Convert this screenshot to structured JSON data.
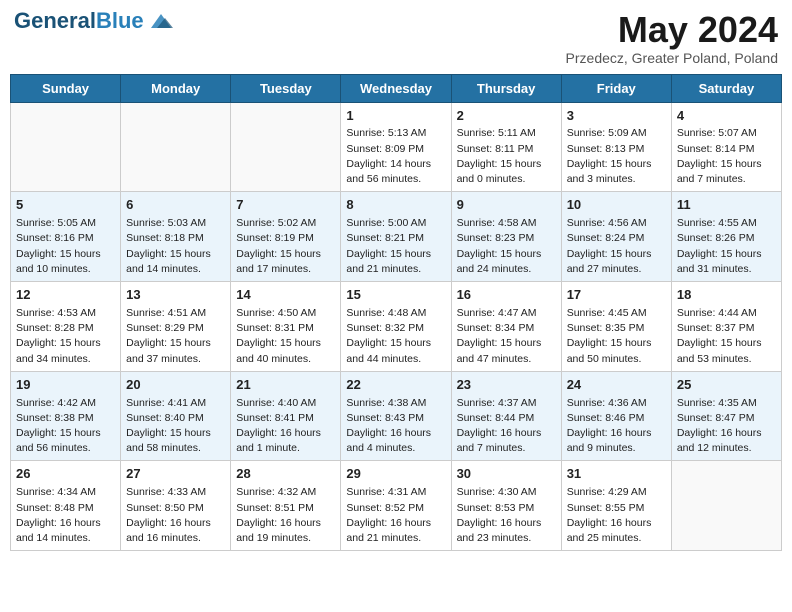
{
  "header": {
    "logo_line1": "General",
    "logo_line2": "Blue",
    "month": "May 2024",
    "location": "Przedecz, Greater Poland, Poland"
  },
  "days_of_week": [
    "Sunday",
    "Monday",
    "Tuesday",
    "Wednesday",
    "Thursday",
    "Friday",
    "Saturday"
  ],
  "weeks": [
    [
      {
        "day": "",
        "content": ""
      },
      {
        "day": "",
        "content": ""
      },
      {
        "day": "",
        "content": ""
      },
      {
        "day": "1",
        "content": "Sunrise: 5:13 AM\nSunset: 8:09 PM\nDaylight: 14 hours\nand 56 minutes."
      },
      {
        "day": "2",
        "content": "Sunrise: 5:11 AM\nSunset: 8:11 PM\nDaylight: 15 hours\nand 0 minutes."
      },
      {
        "day": "3",
        "content": "Sunrise: 5:09 AM\nSunset: 8:13 PM\nDaylight: 15 hours\nand 3 minutes."
      },
      {
        "day": "4",
        "content": "Sunrise: 5:07 AM\nSunset: 8:14 PM\nDaylight: 15 hours\nand 7 minutes."
      }
    ],
    [
      {
        "day": "5",
        "content": "Sunrise: 5:05 AM\nSunset: 8:16 PM\nDaylight: 15 hours\nand 10 minutes."
      },
      {
        "day": "6",
        "content": "Sunrise: 5:03 AM\nSunset: 8:18 PM\nDaylight: 15 hours\nand 14 minutes."
      },
      {
        "day": "7",
        "content": "Sunrise: 5:02 AM\nSunset: 8:19 PM\nDaylight: 15 hours\nand 17 minutes."
      },
      {
        "day": "8",
        "content": "Sunrise: 5:00 AM\nSunset: 8:21 PM\nDaylight: 15 hours\nand 21 minutes."
      },
      {
        "day": "9",
        "content": "Sunrise: 4:58 AM\nSunset: 8:23 PM\nDaylight: 15 hours\nand 24 minutes."
      },
      {
        "day": "10",
        "content": "Sunrise: 4:56 AM\nSunset: 8:24 PM\nDaylight: 15 hours\nand 27 minutes."
      },
      {
        "day": "11",
        "content": "Sunrise: 4:55 AM\nSunset: 8:26 PM\nDaylight: 15 hours\nand 31 minutes."
      }
    ],
    [
      {
        "day": "12",
        "content": "Sunrise: 4:53 AM\nSunset: 8:28 PM\nDaylight: 15 hours\nand 34 minutes."
      },
      {
        "day": "13",
        "content": "Sunrise: 4:51 AM\nSunset: 8:29 PM\nDaylight: 15 hours\nand 37 minutes."
      },
      {
        "day": "14",
        "content": "Sunrise: 4:50 AM\nSunset: 8:31 PM\nDaylight: 15 hours\nand 40 minutes."
      },
      {
        "day": "15",
        "content": "Sunrise: 4:48 AM\nSunset: 8:32 PM\nDaylight: 15 hours\nand 44 minutes."
      },
      {
        "day": "16",
        "content": "Sunrise: 4:47 AM\nSunset: 8:34 PM\nDaylight: 15 hours\nand 47 minutes."
      },
      {
        "day": "17",
        "content": "Sunrise: 4:45 AM\nSunset: 8:35 PM\nDaylight: 15 hours\nand 50 minutes."
      },
      {
        "day": "18",
        "content": "Sunrise: 4:44 AM\nSunset: 8:37 PM\nDaylight: 15 hours\nand 53 minutes."
      }
    ],
    [
      {
        "day": "19",
        "content": "Sunrise: 4:42 AM\nSunset: 8:38 PM\nDaylight: 15 hours\nand 56 minutes."
      },
      {
        "day": "20",
        "content": "Sunrise: 4:41 AM\nSunset: 8:40 PM\nDaylight: 15 hours\nand 58 minutes."
      },
      {
        "day": "21",
        "content": "Sunrise: 4:40 AM\nSunset: 8:41 PM\nDaylight: 16 hours\nand 1 minute."
      },
      {
        "day": "22",
        "content": "Sunrise: 4:38 AM\nSunset: 8:43 PM\nDaylight: 16 hours\nand 4 minutes."
      },
      {
        "day": "23",
        "content": "Sunrise: 4:37 AM\nSunset: 8:44 PM\nDaylight: 16 hours\nand 7 minutes."
      },
      {
        "day": "24",
        "content": "Sunrise: 4:36 AM\nSunset: 8:46 PM\nDaylight: 16 hours\nand 9 minutes."
      },
      {
        "day": "25",
        "content": "Sunrise: 4:35 AM\nSunset: 8:47 PM\nDaylight: 16 hours\nand 12 minutes."
      }
    ],
    [
      {
        "day": "26",
        "content": "Sunrise: 4:34 AM\nSunset: 8:48 PM\nDaylight: 16 hours\nand 14 minutes."
      },
      {
        "day": "27",
        "content": "Sunrise: 4:33 AM\nSunset: 8:50 PM\nDaylight: 16 hours\nand 16 minutes."
      },
      {
        "day": "28",
        "content": "Sunrise: 4:32 AM\nSunset: 8:51 PM\nDaylight: 16 hours\nand 19 minutes."
      },
      {
        "day": "29",
        "content": "Sunrise: 4:31 AM\nSunset: 8:52 PM\nDaylight: 16 hours\nand 21 minutes."
      },
      {
        "day": "30",
        "content": "Sunrise: 4:30 AM\nSunset: 8:53 PM\nDaylight: 16 hours\nand 23 minutes."
      },
      {
        "day": "31",
        "content": "Sunrise: 4:29 AM\nSunset: 8:55 PM\nDaylight: 16 hours\nand 25 minutes."
      },
      {
        "day": "",
        "content": ""
      }
    ]
  ]
}
